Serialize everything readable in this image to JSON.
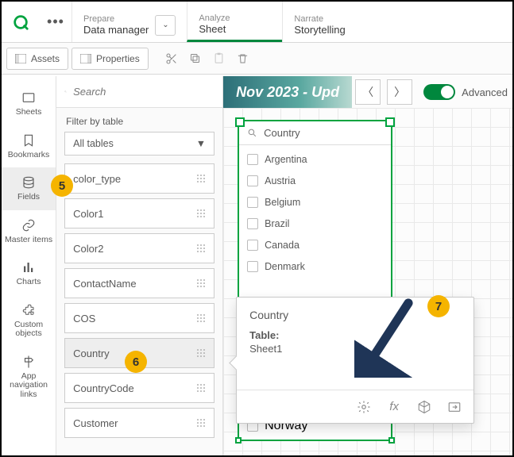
{
  "top": {
    "prepare_sub": "Prepare",
    "prepare_main": "Data manager",
    "analyze_sub": "Analyze",
    "analyze_main": "Sheet",
    "narrate_sub": "Narrate",
    "narrate_main": "Storytelling"
  },
  "toolbar": {
    "assets": "Assets",
    "properties": "Properties"
  },
  "rail": [
    {
      "label": "Sheets"
    },
    {
      "label": "Bookmarks"
    },
    {
      "label": "Fields"
    },
    {
      "label": "Master items"
    },
    {
      "label": "Charts"
    },
    {
      "label": "Custom objects"
    },
    {
      "label": "App navigation links"
    }
  ],
  "panel": {
    "search_placeholder": "Search",
    "filter_label": "Filter by table",
    "tables_dd": "All tables",
    "fields": [
      "color_type",
      "Color1",
      "Color2",
      "ContactName",
      "COS",
      "Country",
      "CountryCode",
      "Customer"
    ]
  },
  "sheet": {
    "title": "Nov 2023 - Upd",
    "advanced_label": "Advanced"
  },
  "filterpane": {
    "title": "Country",
    "items": [
      "Argentina",
      "Austria",
      "Belgium",
      "Brazil",
      "Canada",
      "Denmark"
    ],
    "overflow_item": "Norway"
  },
  "popover": {
    "title": "Country",
    "table_label": "Table:",
    "table_value": "Sheet1"
  },
  "markers": {
    "m5": "5",
    "m6": "6",
    "m7": "7"
  }
}
